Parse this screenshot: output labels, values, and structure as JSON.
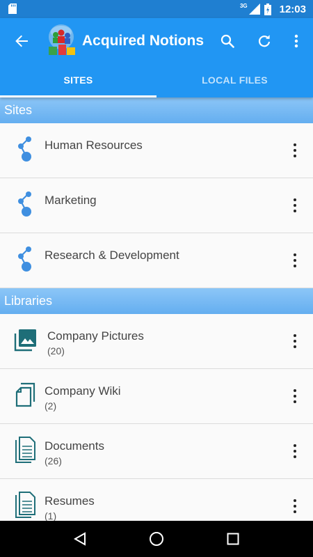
{
  "status_bar": {
    "time": "12:03",
    "network": "3G"
  },
  "app_bar": {
    "title": "Acquired Notions",
    "tabs": [
      {
        "label": "SITES",
        "active": true
      },
      {
        "label": "LOCAL FILES",
        "active": false
      }
    ]
  },
  "sections": {
    "sites": {
      "header": "Sites",
      "items": [
        {
          "label": "Human Resources",
          "icon": "site-icon"
        },
        {
          "label": "Marketing",
          "icon": "site-icon"
        },
        {
          "label": "Research & Development",
          "icon": "site-icon"
        }
      ]
    },
    "libraries": {
      "header": "Libraries",
      "items": [
        {
          "label": "Company Pictures",
          "count": "(20)",
          "icon": "picture-library-icon"
        },
        {
          "label": "Company Wiki",
          "count": "(2)",
          "icon": "wiki-library-icon"
        },
        {
          "label": "Documents",
          "count": "(26)",
          "icon": "document-library-icon"
        },
        {
          "label": "Resumes",
          "count": "(1)",
          "icon": "document-library-icon"
        }
      ]
    }
  },
  "colors": {
    "primary": "#2196f3",
    "status_bar": "#1f7fd1",
    "section_header": "#64aef0",
    "site_icon": "#3f8fe0",
    "library_icon": "#1e6e78"
  }
}
